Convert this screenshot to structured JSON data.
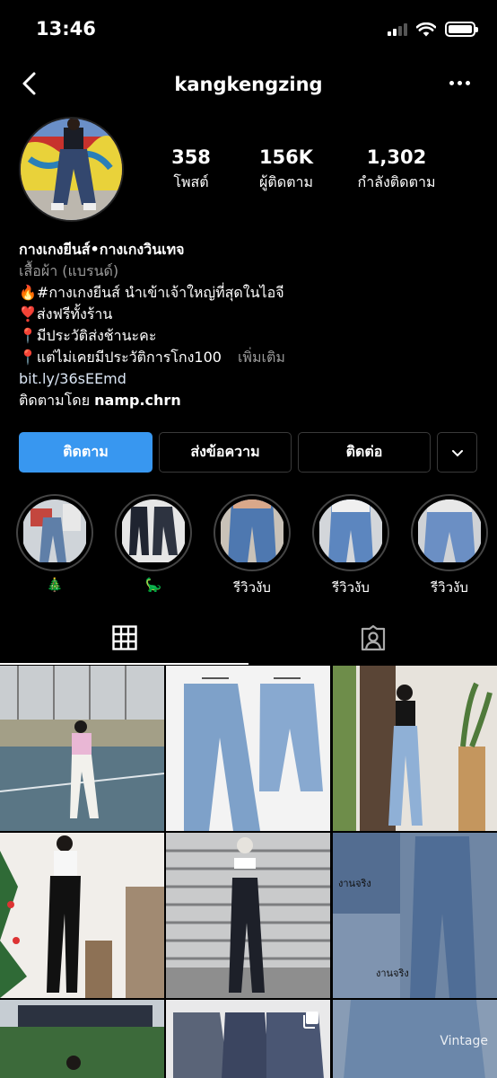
{
  "status": {
    "time": "13:46"
  },
  "profile": {
    "username": "kangkengzing",
    "posts_count": "358",
    "posts_label": "โพสต์",
    "followers_count": "156K",
    "followers_label": "ผู้ติดตาม",
    "following_count": "1,302",
    "following_label": "กำลังติดตาม"
  },
  "bio": {
    "name": "กางเกงยีนส์•กางเกงวินเทจ",
    "category": "เสื้อผ้า (แบรนด์)",
    "lines": [
      {
        "emoji": "🔥",
        "text": "#กางเกงยีนส์ นำเข้าเจ้าใหญ่ที่สุดในไอจี"
      },
      {
        "emoji": "❣️",
        "text": "ส่งฟรีทั้งร้าน"
      },
      {
        "emoji": "📍",
        "text": "มีประวัติส่งช้านะคะ"
      },
      {
        "emoji": "📍",
        "text": "แต่ไม่เคยมีประวัติการโกง100"
      }
    ],
    "more": "เพิ่มเติม",
    "link": "bit.ly/36sEEmd",
    "followed_by_prefix": "ติดตามโดย",
    "followed_by_user": "namp.chrn"
  },
  "actions": {
    "follow": "ติดตาม",
    "message": "ส่งข้อความ",
    "contact": "ติดต่อ"
  },
  "highlights": [
    {
      "label": "🎄"
    },
    {
      "label": "🦕"
    },
    {
      "label": "รีวิวงับ"
    },
    {
      "label": "รีวิวงับ"
    },
    {
      "label": "รีวิวงับ"
    }
  ],
  "grid": {
    "watermark": "Vintage",
    "tags": {
      "real1": "งานจริง",
      "real2": "งานจริง"
    }
  },
  "colors": {
    "background": "#000000",
    "follow_button": "#3897f0",
    "muted_text": "#9a9a9a"
  },
  "icons": [
    "back-arrow-icon",
    "more-options-icon",
    "chevron-down-icon",
    "grid-icon",
    "tagged-icon",
    "multiple-posts-icon"
  ]
}
